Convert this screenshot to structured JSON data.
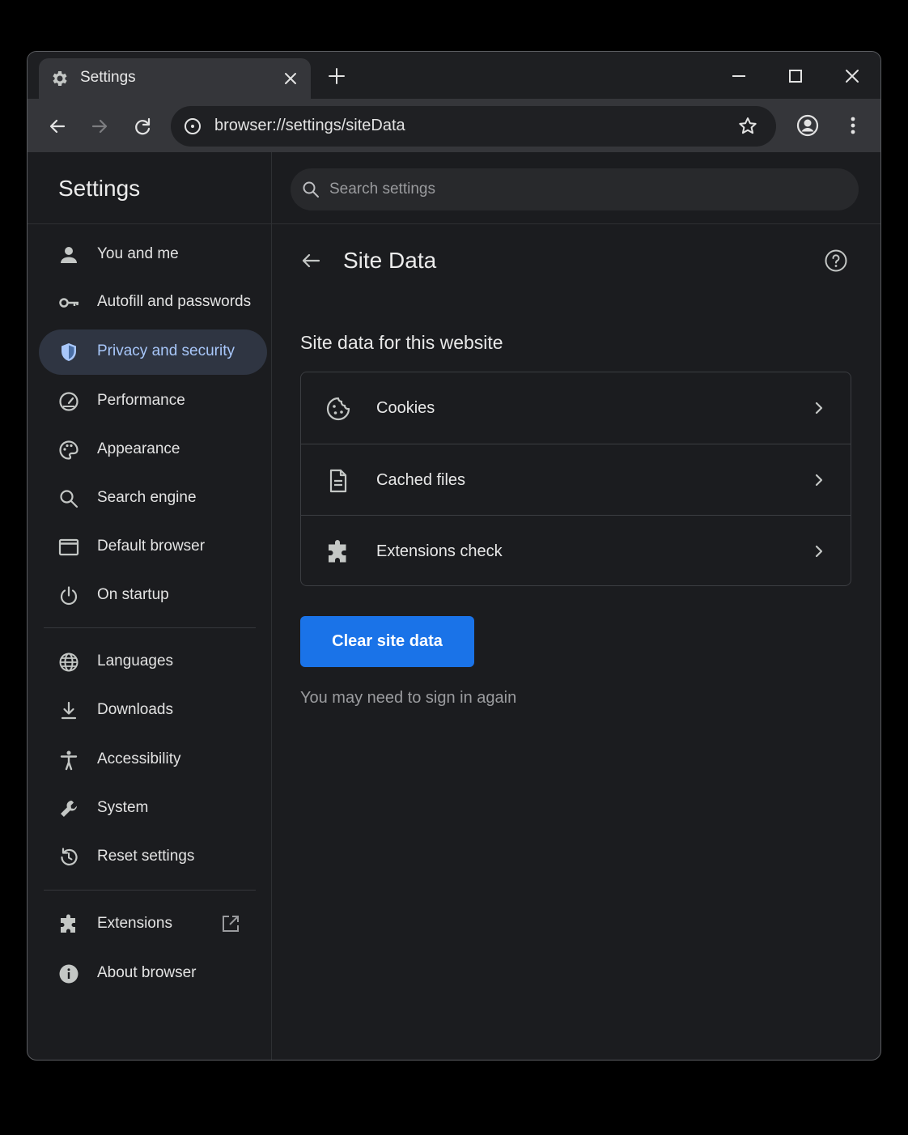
{
  "tab": {
    "title": "Settings"
  },
  "toolbar": {
    "url": "browser://settings/siteData"
  },
  "settings": {
    "title": "Settings"
  },
  "search": {
    "placeholder": "Search settings"
  },
  "sidebar": {
    "items": [
      {
        "label": "You and me",
        "icon": "person-icon"
      },
      {
        "label": "Autofill and passwords",
        "icon": "key-icon"
      },
      {
        "label": "Privacy and security",
        "icon": "shield-icon"
      },
      {
        "label": "Performance",
        "icon": "speedometer-icon"
      },
      {
        "label": "Appearance",
        "icon": "palette-icon"
      },
      {
        "label": "Search engine",
        "icon": "search-icon"
      },
      {
        "label": "Default browser",
        "icon": "browser-window-icon"
      },
      {
        "label": "On startup",
        "icon": "power-icon"
      },
      {
        "label": "Languages",
        "icon": "globe-icon"
      },
      {
        "label": "Downloads",
        "icon": "download-icon"
      },
      {
        "label": "Accessibility",
        "icon": "accessibility-icon"
      },
      {
        "label": "System",
        "icon": "wrench-icon"
      },
      {
        "label": "Reset settings",
        "icon": "history-icon"
      },
      {
        "label": "Extensions",
        "icon": "puzzle-icon"
      },
      {
        "label": "About browser",
        "icon": "info-icon"
      }
    ],
    "active_item": "Privacy and security"
  },
  "main": {
    "page_title": "Site Data",
    "section_title": "Site data for this website",
    "rows": [
      {
        "label": "Cookies",
        "icon": "cookie-icon"
      },
      {
        "label": "Cached files",
        "icon": "document-icon"
      },
      {
        "label": "Extensions check",
        "icon": "puzzle-icon"
      }
    ],
    "clear_button": "Clear site data",
    "hint": "You may need to sign in again"
  },
  "colors": {
    "accent": "#1a73e8",
    "active_text": "#a8c7fa",
    "active_bg": "#2f3542",
    "background": "#1b1c1f"
  }
}
